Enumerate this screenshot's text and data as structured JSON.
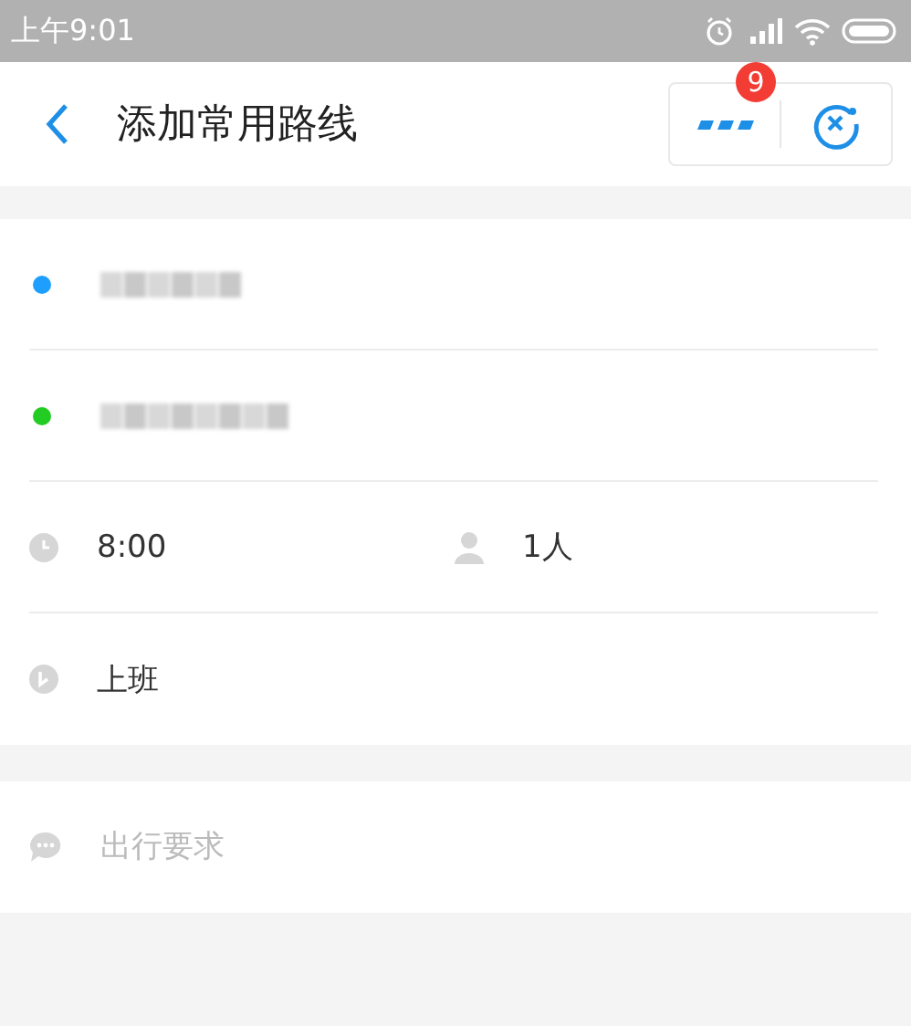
{
  "status_bar": {
    "time": "上午9:01"
  },
  "header": {
    "title": "添加常用路线",
    "menu_badge": "9"
  },
  "places": [
    {
      "kind": "redacted",
      "color": "#1e9fff"
    },
    {
      "kind": "redacted",
      "color": "#22cc22"
    }
  ],
  "time": "8:00",
  "passengers": "1人",
  "tag": "上班",
  "remark": {
    "placeholder": "出行要求"
  }
}
